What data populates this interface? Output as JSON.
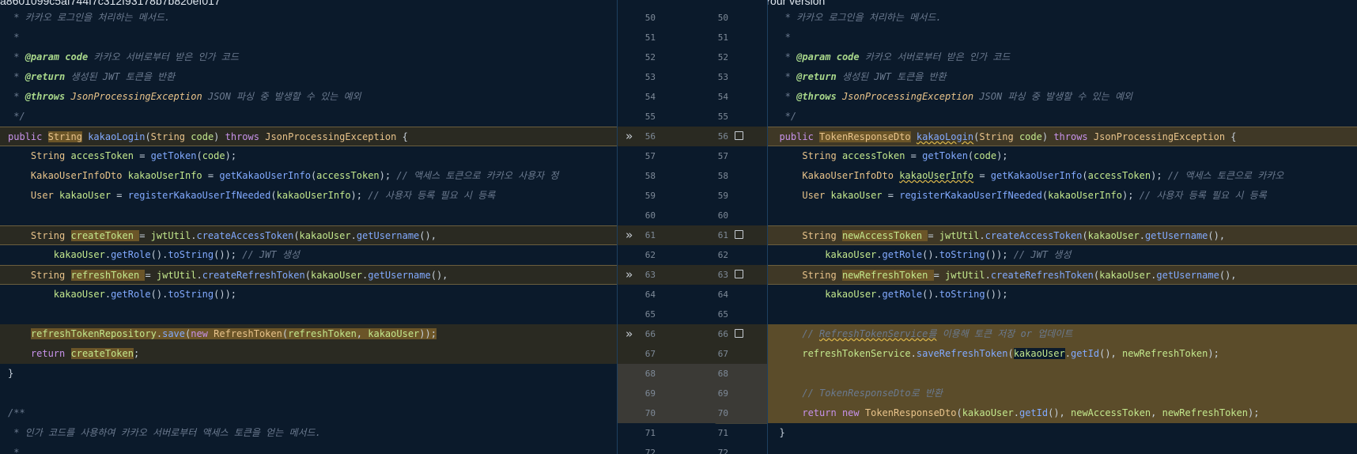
{
  "left_header": "a8601099c5af744f7c312f93178b7b820ef017",
  "right_header": "Your version",
  "left_lines": [
    {
      "html": "<span class=\"cm\"> * 카카오 로그인을 처리하는 메서드.</span>"
    },
    {
      "html": "<span class=\"cm\"> *</span>"
    },
    {
      "html": "<span class=\"cm\"> * </span><span class=\"cmk\">@param</span><span class=\"cm\"> </span><span class=\"cmk\">code</span><span class=\"cm\"> 카카오 서버로부터 받은 인가 코드</span>"
    },
    {
      "html": "<span class=\"cm\"> * </span><span class=\"cmk\">@return</span><span class=\"cm\"> 생성된 JWT 토큰을 반환</span>"
    },
    {
      "html": "<span class=\"cm\"> * </span><span class=\"cmk\">@throws</span><span class=\"cm\"> </span><span class=\"cmt\">JsonProcessingException</span><span class=\"cm\"> JSON 파싱 중 발생할 수 있는 예외</span>"
    },
    {
      "html": "<span class=\"cm\"> */</span>"
    },
    {
      "html": "<span class=\"kw\">public</span> <span class=\"ty hl\">String</span> <span class=\"fn\">kakaoLogin</span>(<span class=\"ty\">String</span> <span class=\"var\">code</span>) <span class=\"kw\">throws</span> <span class=\"ty\">JsonProcessingException</span> {",
      "cls": "chg cur"
    },
    {
      "html": "    <span class=\"ty\">String</span> <span class=\"var\">accessToken</span> = <span class=\"fn\">getToken</span>(<span class=\"var\">code</span>);"
    },
    {
      "html": "    <span class=\"ty\">KakaoUserInfoDto</span> <span class=\"var\">kakaoUserInfo</span> = <span class=\"fn\">getKakaoUserInfo</span>(<span class=\"var\">accessToken</span>); <span class=\"cm\">// 액세스 토큰으로 카카오 사용자 정</span>"
    },
    {
      "html": "    <span class=\"ty\">User</span> <span class=\"var\">kakaoUser</span> = <span class=\"fn\">registerKakaoUserIfNeeded</span>(<span class=\"var\">kakaoUserInfo</span>); <span class=\"cm\">// 사용자 등록 필요 시 등록</span>"
    },
    {
      "html": ""
    },
    {
      "html": "    <span class=\"ty\">String</span> <span class=\"var hl\">createToken</span><span class=\"hl\"> </span>= <span class=\"var\">jwtUtil</span>.<span class=\"fn\">createAccessToken</span>(<span class=\"var\">kakaoUser</span>.<span class=\"fn\">getUsername</span>(),",
      "cls": "chg cur"
    },
    {
      "html": "        <span class=\"var\">kakaoUser</span>.<span class=\"fn\">getRole</span>().<span class=\"fn\">toString</span>()); <span class=\"cm\">// JWT 생성</span>"
    },
    {
      "html": "    <span class=\"ty\">String</span> <span class=\"var hl\">refreshToken</span><span class=\"hl\"> </span>= <span class=\"var\">jwtUtil</span>.<span class=\"fn\">createRefreshToken</span>(<span class=\"var\">kakaoUser</span>.<span class=\"fn\">getUsername</span>(),",
      "cls": "chg cur"
    },
    {
      "html": "        <span class=\"var\">kakaoUser</span>.<span class=\"fn\">getRole</span>().<span class=\"fn\">toString</span>());"
    },
    {
      "html": ""
    },
    {
      "html": "    <span class=\"hl\"><span class=\"var\">refreshTokenRepository</span>.<span class=\"fn\">save</span>(<span class=\"kw\">new</span> <span class=\"ty\">RefreshToken</span>(<span class=\"var\">refreshToken</span>, <span class=\"var\">kakaoUser</span>));</span>",
      "cls": "chg"
    },
    {
      "html": "    <span class=\"kw\">return</span> <span class=\"var hl\">createToken</span>;",
      "cls": "chg"
    },
    {
      "html": "}"
    },
    {
      "html": ""
    },
    {
      "html": "<span class=\"cm\">/**</span>"
    },
    {
      "html": "<span class=\"cm\"> * 인가 코드를 사용하여 카카오 서버로부터 액세스 토큰을 얻는 메서드.</span>"
    },
    {
      "html": "<span class=\"cm\"> *</span>"
    }
  ],
  "right_lines": [
    {
      "html": "<span class=\"cm\">   * 카카오 로그인을 처리하는 메서드.</span>"
    },
    {
      "html": "<span class=\"cm\">   *</span>"
    },
    {
      "html": "<span class=\"cm\">   * </span><span class=\"cmk\">@param</span><span class=\"cm\"> </span><span class=\"cmk\">code</span><span class=\"cm\"> 카카오 서버로부터 받은 인가 코드</span>"
    },
    {
      "html": "<span class=\"cm\">   * </span><span class=\"cmk\">@return</span><span class=\"cm\"> 생성된 JWT 토큰을 반환</span>"
    },
    {
      "html": "<span class=\"cm\">   * </span><span class=\"cmk\">@throws</span><span class=\"cm\"> </span><span class=\"cmt\">JsonProcessingException</span><span class=\"cm\"> JSON 파싱 중 발생할 수 있는 예외</span>"
    },
    {
      "html": "<span class=\"cm\">   */</span>"
    },
    {
      "html": "  <span class=\"kw\">public</span> <span class=\"ty hl\">TokenResponseDto</span> <span class=\"fn sq\">kakaoLogin</span>(<span class=\"ty\">String</span> <span class=\"var\">code</span>) <span class=\"kw\">throws</span> <span class=\"ty\">JsonProcessingException</span> {",
      "cls": "chg cur"
    },
    {
      "html": "      <span class=\"ty\">String</span> <span class=\"var\">accessToken</span> = <span class=\"fn\">getToken</span>(<span class=\"var\">code</span>);"
    },
    {
      "html": "      <span class=\"ty\">KakaoUserInfoDto</span> <span class=\"var sq\">kakaoUserInfo</span> = <span class=\"fn\">getKakaoUserInfo</span>(<span class=\"var\">accessToken</span>); <span class=\"cm\">// 액세스 토큰으로 카카오</span>"
    },
    {
      "html": "      <span class=\"ty\">User</span> <span class=\"var\">kakaoUser</span> = <span class=\"fn\">registerKakaoUserIfNeeded</span>(<span class=\"var\">kakaoUserInfo</span>); <span class=\"cm\">// 사용자 등록 필요 시 등록</span>"
    },
    {
      "html": ""
    },
    {
      "html": "      <span class=\"ty\">String</span> <span class=\"var hl\">newAccessToken</span><span class=\"hl\"> </span>= <span class=\"var\">jwtUtil</span>.<span class=\"fn\">createAccessToken</span>(<span class=\"var\">kakaoUser</span>.<span class=\"fn\">getUsername</span>(),",
      "cls": "chg cur"
    },
    {
      "html": "          <span class=\"var\">kakaoUser</span>.<span class=\"fn\">getRole</span>().<span class=\"fn\">toString</span>()); <span class=\"cm\">// JWT 생성</span>"
    },
    {
      "html": "      <span class=\"ty\">String</span> <span class=\"var hl\">newRefreshToken</span><span class=\"hl\"> </span>= <span class=\"var\">jwtUtil</span>.<span class=\"fn\">createRefreshToken</span>(<span class=\"var\">kakaoUser</span>.<span class=\"fn\">getUsername</span>(),",
      "cls": "chg cur"
    },
    {
      "html": "          <span class=\"var\">kakaoUser</span>.<span class=\"fn\">getRole</span>().<span class=\"fn\">toString</span>());"
    },
    {
      "html": ""
    },
    {
      "html": "      <span class=\"cm\">// </span><span class=\"cm sq\">RefreshTokenService를</span><span class=\"cm\"> 이용해 토큰 저장 or 업데이트</span>",
      "cls": "add"
    },
    {
      "html": "      <span class=\"var\">refreshTokenService</span>.<span class=\"fn\">saveRefreshToken</span>(<span class=\"var dk\">kakaoUser</span>.<span class=\"fn\">getId</span>(), <span class=\"var\">newRefreshToken</span>);",
      "cls": "add"
    },
    {
      "html": "",
      "cls": "add"
    },
    {
      "html": "      <span class=\"cm\">// TokenResponseDto로 반환</span>",
      "cls": "add"
    },
    {
      "html": "      <span class=\"kw\">return</span> <span class=\"kw\">new</span> <span class=\"ty\">TokenResponseDto</span>(<span class=\"var\">kakaoUser</span>.<span class=\"fn\">getId</span>(), <span class=\"var\">newAccessToken</span>, <span class=\"var\">newRefreshToken</span>);",
      "cls": "add"
    },
    {
      "html": "  }"
    },
    {
      "html": ""
    }
  ],
  "gutter": [
    {
      "a": "50",
      "b": "50"
    },
    {
      "a": "51",
      "b": "51"
    },
    {
      "a": "52",
      "b": "52"
    },
    {
      "a": "53",
      "b": "53"
    },
    {
      "a": "54",
      "b": "54"
    },
    {
      "a": "55",
      "b": "55"
    },
    {
      "a": "56",
      "b": "56",
      "arrow": "»",
      "check": true,
      "cls": "chg"
    },
    {
      "a": "57",
      "b": "57"
    },
    {
      "a": "58",
      "b": "58"
    },
    {
      "a": "59",
      "b": "59"
    },
    {
      "a": "60",
      "b": "60"
    },
    {
      "a": "61",
      "b": "61",
      "arrow": "»",
      "check": true,
      "cls": "chg"
    },
    {
      "a": "62",
      "b": "62"
    },
    {
      "a": "63",
      "b": "63",
      "arrow": "»",
      "check": true,
      "cls": "chg"
    },
    {
      "a": "64",
      "b": "64"
    },
    {
      "a": "65",
      "b": "65"
    },
    {
      "a": "66",
      "b": "66",
      "arrow": "»",
      "check": true,
      "cls": "chg"
    },
    {
      "a": "67",
      "b": "67",
      "cls": "chg"
    },
    {
      "a": "68",
      "b": "68",
      "cls": "add"
    },
    {
      "a": "69",
      "b": "69",
      "cls": "add"
    },
    {
      "a": "70",
      "b": "70",
      "cls": "add"
    },
    {
      "a": "71",
      "b": "71"
    },
    {
      "a": "72",
      "b": "72"
    }
  ]
}
